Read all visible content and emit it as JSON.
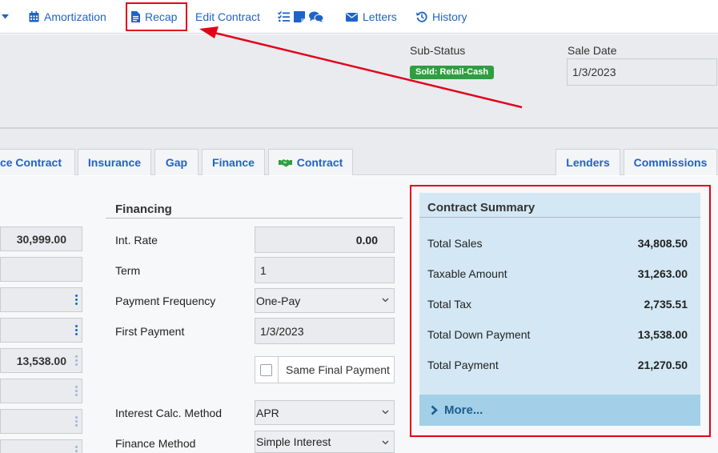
{
  "toolbar": {
    "amortization": "Amortization",
    "recap": "Recap",
    "edit_contract": "Edit Contract",
    "letters": "Letters",
    "history": "History"
  },
  "header": {
    "sub_status_label": "Sub-Status",
    "sub_status_badge": "Sold: Retail-Cash",
    "sale_date_label": "Sale Date",
    "sale_date_value": "1/3/2023"
  },
  "tabs": {
    "service_contract": "ice Contract",
    "insurance": "Insurance",
    "gap": "Gap",
    "finance": "Finance",
    "contract": "Contract",
    "lenders": "Lenders",
    "commissions": "Commissions"
  },
  "left_column": {
    "values": [
      "30,999.00",
      "",
      "",
      "",
      "13,538.00",
      "",
      "",
      ""
    ]
  },
  "financing": {
    "title": "Financing",
    "int_rate_label": "Int. Rate",
    "int_rate_value": "0.00",
    "term_label": "Term",
    "term_value": "1",
    "payment_frequency_label": "Payment Frequency",
    "payment_frequency_value": "One-Pay",
    "first_payment_label": "First Payment",
    "first_payment_value": "1/3/2023",
    "same_final_payment_label": "Same Final Payment",
    "interest_calc_label": "Interest Calc. Method",
    "interest_calc_value": "APR",
    "finance_method_label": "Finance Method",
    "finance_method_value": "Simple Interest"
  },
  "summary": {
    "title": "Contract Summary",
    "rows": [
      {
        "label": "Total Sales",
        "value": "34,808.50"
      },
      {
        "label": "Taxable Amount",
        "value": "31,263.00"
      },
      {
        "label": "Total Tax",
        "value": "2,735.51"
      },
      {
        "label": "Total Down Payment",
        "value": "13,538.00"
      },
      {
        "label": "Total Payment",
        "value": "21,270.50"
      }
    ],
    "more_label": "More..."
  },
  "colors": {
    "link_blue": "#1f63c6",
    "annotation_red": "#e3001b",
    "badge_green": "#2f9e41",
    "summary_bg": "#d3e8f4",
    "more_bg": "#a3cfe9"
  }
}
